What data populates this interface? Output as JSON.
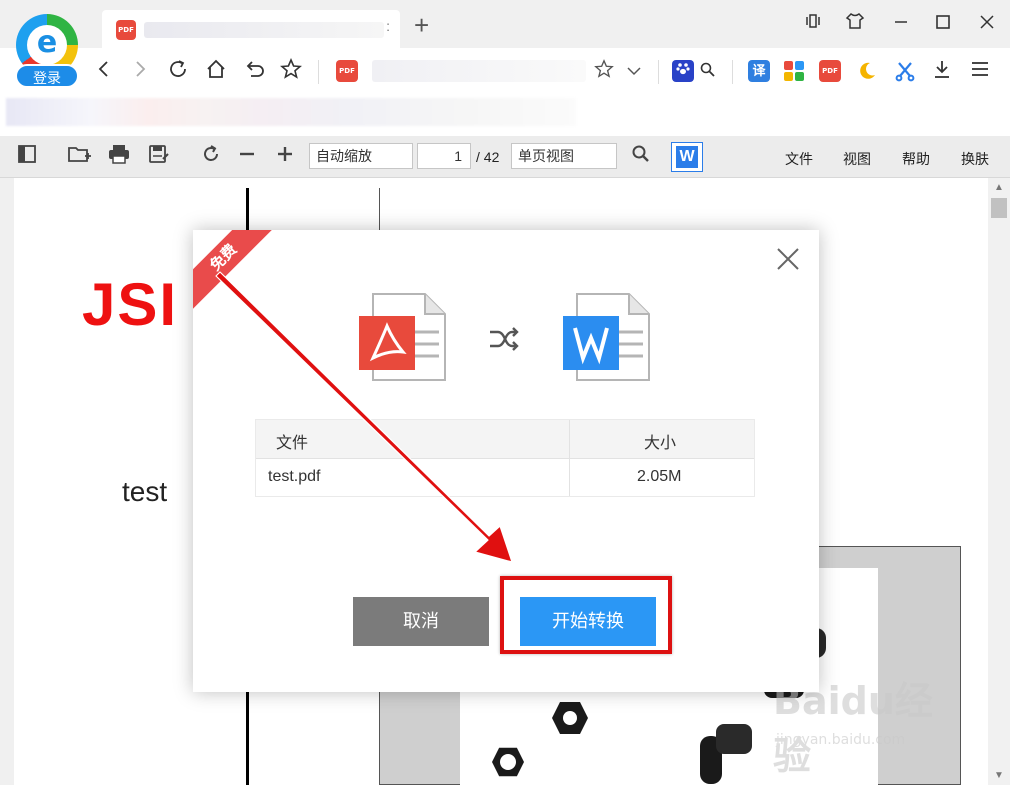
{
  "browser": {
    "login_label": "登录",
    "logo_letter": "e",
    "tab_icon": "PDF",
    "tab_close": ":",
    "new_tab": "+",
    "address_icon": "PDF"
  },
  "pdf_toolbar": {
    "zoom_value": "自动缩放",
    "page_current": "1",
    "page_total": "/ 42",
    "view_mode": "单页视图",
    "wps_label": "W",
    "menu": [
      "文件",
      "视图",
      "帮助",
      "换肤"
    ]
  },
  "document": {
    "logo_text": "JSI",
    "body_text": "test"
  },
  "dialog": {
    "ribbon": "免费",
    "table": {
      "headers": [
        "文件",
        "大小"
      ],
      "rows": [
        [
          "test.pdf",
          "2.05M"
        ]
      ]
    },
    "cancel_label": "取消",
    "start_label": "开始转换"
  },
  "watermark": {
    "brand": "Baidu经验",
    "url": "jingyan.baidu.com"
  },
  "colors": {
    "accent_blue": "#2b97f5",
    "cancel_gray": "#7b7b7b",
    "ribbon_red": "#e94b4b",
    "highlight_red": "#dd1111"
  }
}
